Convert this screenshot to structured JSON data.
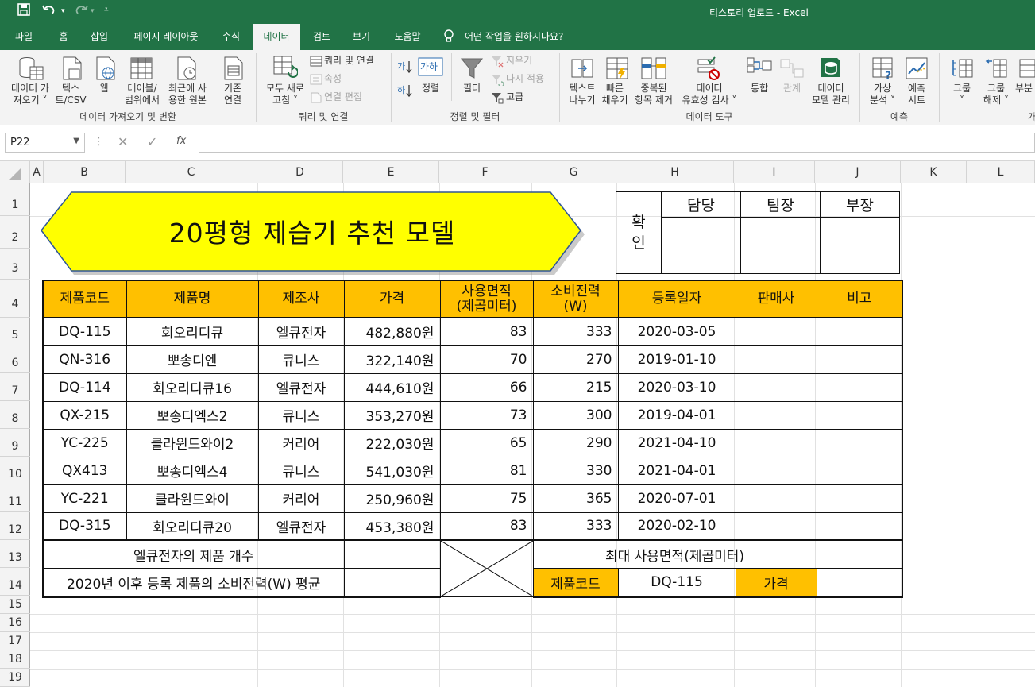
{
  "window": {
    "title": "티스토리 업로드  -  Excel"
  },
  "tabs": [
    "파일",
    "홈",
    "삽입",
    "페이지 레이아웃",
    "수식",
    "데이터",
    "검토",
    "보기",
    "도움말"
  ],
  "tell_me": "어떤 작업을 원하시나요?",
  "ribbon": {
    "get_data": [
      "데이터 가",
      "져오기 ˅"
    ],
    "text_csv": [
      "텍스",
      "트/CSV"
    ],
    "web": "웹",
    "from_table": [
      "테이블/",
      "범위에서"
    ],
    "recent_sources": [
      "최근에 사",
      "용한 원본"
    ],
    "existing_conn": [
      "기존",
      "연결"
    ],
    "group_get": "데이터 가져오기 및 변환",
    "refresh_all": [
      "모두 새로",
      "고침 ˅"
    ],
    "queries_conn": "쿼리 및 연결",
    "properties": "속성",
    "edit_links": "연결 편집",
    "group_queries": "쿼리 및 연결",
    "sort": "정렬",
    "filter": "필터",
    "clear": "지우기",
    "reapply": "다시 적용",
    "advanced": "고급",
    "group_sort": "정렬 및 필터",
    "text_to_cols": [
      "텍스트",
      "나누기"
    ],
    "flash_fill": [
      "빠른",
      "채우기"
    ],
    "remove_dup": [
      "중복된",
      "항목 제거"
    ],
    "validation": [
      "데이터",
      "유효성 검사 ˅"
    ],
    "consolidate": "통합",
    "relations": "관계",
    "data_model": [
      "데이터",
      "모델 관리"
    ],
    "group_tools": "데이터 도구",
    "what_if": [
      "가상",
      "분석 ˅"
    ],
    "forecast": [
      "예측",
      "시트"
    ],
    "group_forecast": "예측",
    "group_btn": [
      "그룹",
      "˅"
    ],
    "ungroup": [
      "그룹",
      "해제 ˅"
    ],
    "subtotal": "부분",
    "group_outline": "개"
  },
  "formula_bar": {
    "name_box": "P22",
    "fx": "fx",
    "formula": ""
  },
  "columns": [
    "A",
    "B",
    "C",
    "D",
    "E",
    "F",
    "G",
    "H",
    "I",
    "J",
    "K",
    "L"
  ],
  "rows": [
    "1",
    "2",
    "3",
    "4",
    "5",
    "6",
    "7",
    "8",
    "9",
    "10",
    "11",
    "12",
    "13",
    "14",
    "15",
    "16",
    "17",
    "18",
    "19"
  ],
  "sheet": {
    "title": "20평형 제습기 추천 모델",
    "sign": {
      "confirm": [
        "확",
        "인"
      ],
      "roles": [
        "담당",
        "팀장",
        "부장"
      ]
    },
    "headers": [
      "제품코드",
      "제품명",
      "제조사",
      "가격",
      "사용면적\n(제곱미터)",
      "소비전력\n(W)",
      "등록일자",
      "판매사",
      "비고"
    ],
    "rows": [
      {
        "code": "DQ-115",
        "name": "회오리디큐",
        "maker": "엘큐전자",
        "price": "482,880원",
        "area": "83",
        "power": "333",
        "date": "2020-03-05"
      },
      {
        "code": "QN-316",
        "name": "뽀송디엔",
        "maker": "큐니스",
        "price": "322,140원",
        "area": "70",
        "power": "270",
        "date": "2019-01-10"
      },
      {
        "code": "DQ-114",
        "name": "회오리디큐16",
        "maker": "엘큐전자",
        "price": "444,610원",
        "area": "66",
        "power": "215",
        "date": "2020-03-10"
      },
      {
        "code": "QX-215",
        "name": "뽀송디엑스2",
        "maker": "큐니스",
        "price": "353,270원",
        "area": "73",
        "power": "300",
        "date": "2019-04-01"
      },
      {
        "code": "YC-225",
        "name": "클라윈드와이2",
        "maker": "커리어",
        "price": "222,030원",
        "area": "65",
        "power": "290",
        "date": "2021-04-10"
      },
      {
        "code": "QX413",
        "name": "뽀송디엑스4",
        "maker": "큐니스",
        "price": "541,030원",
        "area": "81",
        "power": "330",
        "date": "2021-04-01"
      },
      {
        "code": "YC-221",
        "name": "클라윈드와이",
        "maker": "커리어",
        "price": "250,960원",
        "area": "75",
        "power": "365",
        "date": "2020-07-01"
      },
      {
        "code": "DQ-315",
        "name": "회오리디큐20",
        "maker": "엘큐전자",
        "price": "453,380원",
        "area": "83",
        "power": "333",
        "date": "2020-02-10"
      }
    ],
    "summary1_label": "엘큐전자의 제품 개수",
    "summary2_label": "2020년 이후 등록 제품의 소비전력(W) 평균",
    "max_area_label": "최대 사용면적(제곱미터)",
    "code_label": "제품코드",
    "code_value": "DQ-115",
    "price_label": "가격"
  },
  "colors": {
    "excel_green": "#217346",
    "header_orange": "#ffc000",
    "title_yellow": "#ffff00"
  }
}
